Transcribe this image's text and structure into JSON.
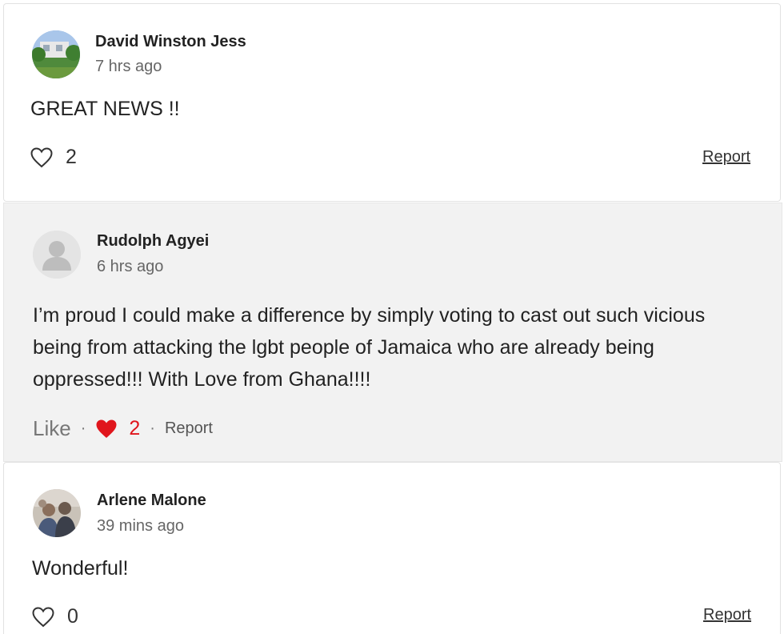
{
  "comments": [
    {
      "author": "David Winston Jess",
      "time": "7 hrs ago",
      "text": "GREAT NEWS !!",
      "likes": "2",
      "report": "Report",
      "avatar": "landscape-photo"
    },
    {
      "author": "Rudolph Agyei",
      "time": "6 hrs ago",
      "text": "I’m proud I could make a difference by simply voting to cast out such vicious being from attacking the lgbt people of Jamaica who are already being oppressed!!! With Love from Ghana!!!!",
      "like_label": "Like",
      "sep": "·",
      "likes": "2",
      "report": "Report",
      "liked": true,
      "avatar": "default-user"
    },
    {
      "author": "Arlene Malone",
      "time": "39 mins ago",
      "text": "Wonderful!",
      "likes": "0",
      "report": "Report",
      "avatar": "group-photo"
    }
  ],
  "colors": {
    "like_red": "#e0151c",
    "highlight_bg": "#f2f2f2"
  }
}
